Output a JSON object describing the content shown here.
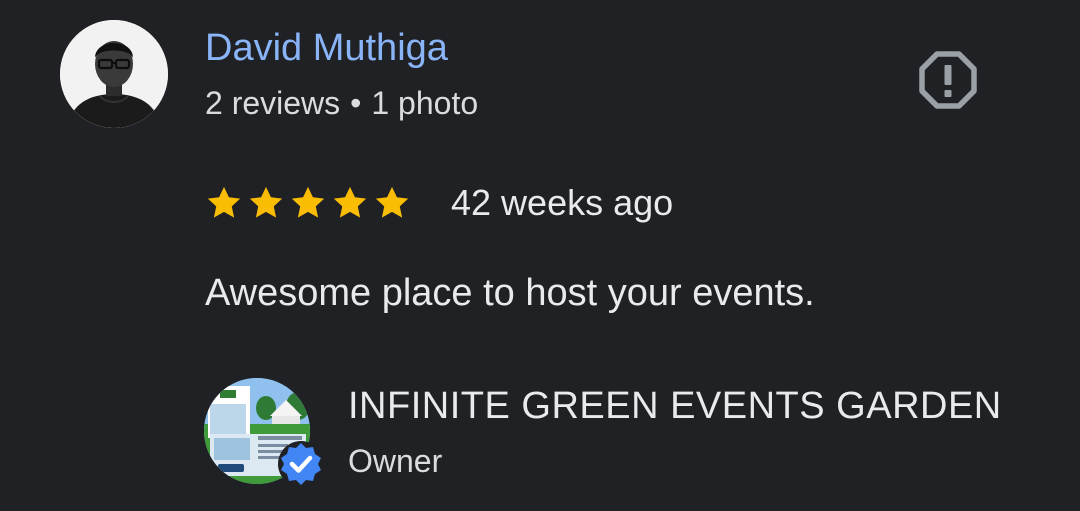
{
  "reviewer": {
    "name": "David Muthiga",
    "reviews_count": "2 reviews",
    "separator": "•",
    "photos_count": "1 photo",
    "avatar_icon": "person-avatar-icon"
  },
  "review": {
    "rating": 5,
    "max_rating": 5,
    "time_ago": "42 weeks ago",
    "text": "Awesome place to host your events."
  },
  "owner_response": {
    "business_name": "INFINITE GREEN EVENTS GARDEN",
    "role": "Owner",
    "verified": true
  },
  "icons": {
    "report": "report-octagon-icon",
    "star": "star-icon",
    "verified": "verified-badge-icon"
  },
  "colors": {
    "background": "#202124",
    "name_link": "#8ab4f8",
    "star": "#fbbc04",
    "verified": "#1a73e8",
    "report_icon": "#9aa0a6"
  }
}
